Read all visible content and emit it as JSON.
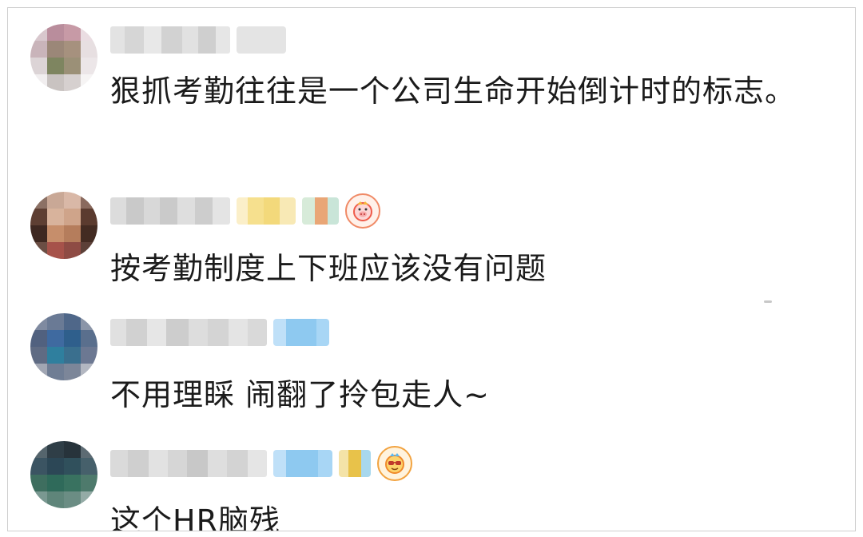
{
  "comments": [
    {
      "text": "狠抓考勤往往是一个公司生命开始倒计时的标志。"
    },
    {
      "text": "按考勤制度上下班应该没有问题"
    },
    {
      "text": "不用理睬 闹翻了拎包走人~"
    },
    {
      "text": "这个HR脑残"
    }
  ],
  "icons": {
    "medal_1": "pig-medal-icon",
    "medal_2": "sunglasses-medal-icon"
  }
}
